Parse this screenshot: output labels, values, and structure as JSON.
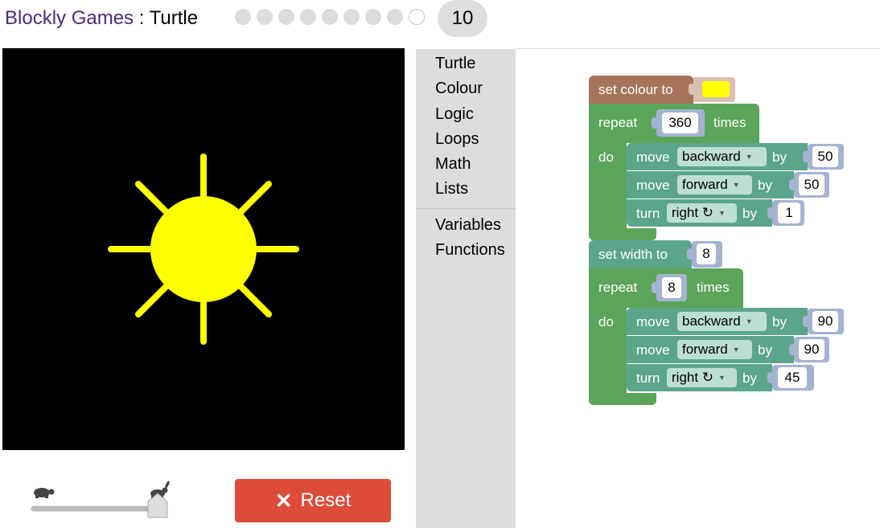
{
  "header": {
    "app_name": "Blockly Games",
    "separator": " : ",
    "game_name": "Turtle",
    "level_count": 9,
    "current_level": "10"
  },
  "controls": {
    "reset_icon": "close-icon",
    "reset_label": "Reset",
    "speed_value": 1.0
  },
  "toolbox": {
    "categories": [
      "Turtle",
      "Colour",
      "Logic",
      "Loops",
      "Math",
      "Lists"
    ],
    "extra_categories": [
      "Variables",
      "Functions"
    ]
  },
  "blocks": {
    "set_colour_label": "set colour to",
    "colour_value": "#ffff00",
    "repeat1": {
      "label": "repeat",
      "count": "360",
      "times": "times",
      "do": "do"
    },
    "move1": {
      "label": "move",
      "dir": "backward",
      "by": "by",
      "value": "50"
    },
    "move2": {
      "label": "move",
      "dir": "forward",
      "by": "by",
      "value": "50"
    },
    "turn1": {
      "label": "turn",
      "dir": "right ↻",
      "by": "by",
      "value": "1"
    },
    "set_width_label": "set width to",
    "width_value": "8",
    "repeat2": {
      "label": "repeat",
      "count": "8",
      "times": "times",
      "do": "do"
    },
    "move3": {
      "label": "move",
      "dir": "backward",
      "by": "by",
      "value": "90"
    },
    "move4": {
      "label": "move",
      "dir": "forward",
      "by": "by",
      "value": "90"
    },
    "turn2": {
      "label": "turn",
      "dir": "right ↻",
      "by": "by",
      "value": "45"
    }
  },
  "colors": {
    "colour_block": "#a5745b",
    "loop_block": "#5ba55b",
    "turtle_block": "#5ba58c",
    "math_socket": "#a5b3d2",
    "drawing": "#ffff00",
    "canvas": "#000000",
    "reset_button": "#dd4b39"
  }
}
